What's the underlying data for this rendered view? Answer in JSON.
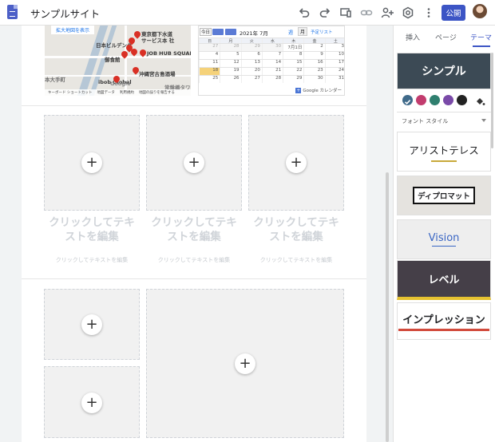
{
  "app": {
    "site_title": "サンプルサイト",
    "publish_label": "公開"
  },
  "map": {
    "enlarge_link": "拡大地図を表示",
    "labels": [
      "東京都下水道",
      "サービス本 社",
      "日本ビルデング",
      "御食館",
      "JOB HUB SQUARE",
      "沖縄宮古島酒場",
      "ibob Global",
      "常盤橋タワー",
      "本大手町"
    ],
    "google_label": "Google",
    "footer": [
      "キーボード ショートカット",
      "地図データ",
      "利用規約",
      "地図の誤りを報告する"
    ]
  },
  "calendar": {
    "today": "今日",
    "month": "2021年 7月",
    "week": "週",
    "month_btn": "月",
    "list": "予定リスト",
    "weekdays": [
      "日",
      "月",
      "火",
      "水",
      "木",
      "金",
      "土"
    ],
    "weeks": [
      [
        {
          "d": "27",
          "dim": true
        },
        {
          "d": "28",
          "dim": true
        },
        {
          "d": "29",
          "dim": true
        },
        {
          "d": "30",
          "dim": true
        },
        {
          "d": "7月1日"
        },
        {
          "d": "2"
        },
        {
          "d": "3"
        }
      ],
      [
        {
          "d": "4"
        },
        {
          "d": "5"
        },
        {
          "d": "6"
        },
        {
          "d": "7"
        },
        {
          "d": "8"
        },
        {
          "d": "9"
        },
        {
          "d": "10"
        }
      ],
      [
        {
          "d": "11"
        },
        {
          "d": "12"
        },
        {
          "d": "13"
        },
        {
          "d": "14"
        },
        {
          "d": "15"
        },
        {
          "d": "16"
        },
        {
          "d": "17"
        }
      ],
      [
        {
          "d": "18",
          "hl": true
        },
        {
          "d": "19"
        },
        {
          "d": "20"
        },
        {
          "d": "21"
        },
        {
          "d": "22"
        },
        {
          "d": "23"
        },
        {
          "d": "24"
        }
      ],
      [
        {
          "d": "25"
        },
        {
          "d": "26"
        },
        {
          "d": "27"
        },
        {
          "d": "28"
        },
        {
          "d": "29"
        },
        {
          "d": "30"
        },
        {
          "d": "31"
        }
      ]
    ],
    "footer": "Google カレンダー"
  },
  "placeholders": {
    "plus": "+",
    "title": "クリックしてテキストを編集",
    "subtitle": "クリックしてテキストを編集"
  },
  "panel": {
    "tabs": [
      "挿入",
      "ページ",
      "テーマ"
    ],
    "themes": {
      "simple": "シンプル",
      "aristoteles": "アリストテレス",
      "diplomat": "ディプロマット",
      "vision": "Vision",
      "level": "レベル",
      "impression": "インプレッション"
    },
    "font_style_label": "フォント スタイル",
    "swatches": [
      "#3f6a8a",
      "#c23c6e",
      "#2f7f6f",
      "#7a4aa8",
      "#222222"
    ]
  },
  "icons": [
    "doc-icon",
    "undo-icon",
    "redo-icon",
    "preview-icon",
    "link-icon",
    "share-icon",
    "settings-icon",
    "more-icon",
    "paint-bucket-icon",
    "checkmark-icon"
  ]
}
